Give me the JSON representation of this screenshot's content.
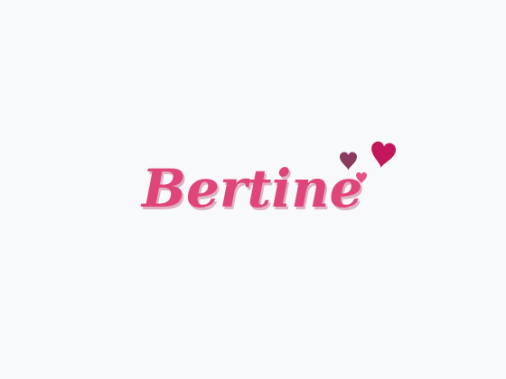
{
  "logo": {
    "text": "Bertine",
    "colors": {
      "text": "#e0457a",
      "text_highlight": "#f27aa4",
      "text_shadow": "#b02a5a",
      "heart_plum": "#8a3a5e",
      "heart_magenta": "#c2185b",
      "heart_pink": "#e8508a",
      "background": "#f8f9fb"
    },
    "icons": [
      "heart-icon",
      "heart-icon",
      "heart-icon"
    ]
  }
}
